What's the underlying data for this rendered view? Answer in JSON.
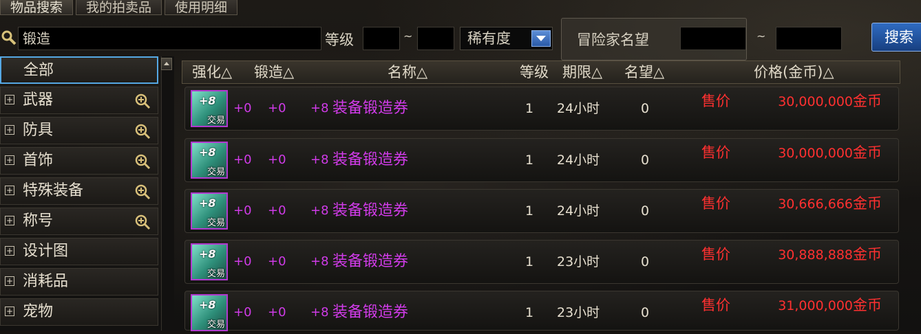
{
  "tabs": [
    {
      "label": "物品搜索"
    },
    {
      "label": "我的拍卖品"
    },
    {
      "label": "使用明细"
    }
  ],
  "search": {
    "keyword": "锻造",
    "level_label": "等级",
    "tilde": "~",
    "rarity_label": "稀有度",
    "reputation_label": "冒险家名望",
    "search_button": "搜索"
  },
  "sidebar": {
    "items": [
      {
        "label": "全部"
      },
      {
        "label": "武器"
      },
      {
        "label": "防具"
      },
      {
        "label": "首饰"
      },
      {
        "label": "特殊装备"
      },
      {
        "label": "称号"
      },
      {
        "label": "设计图"
      },
      {
        "label": "消耗品"
      },
      {
        "label": "宠物"
      }
    ]
  },
  "table": {
    "headers": {
      "enhance": "强化△",
      "forge": "锻造△",
      "name": "名称△",
      "level": "等级",
      "period": "期限△",
      "reputation": "名望△",
      "price": "价格(金币)△"
    },
    "rows": [
      {
        "icon_badge": "+8",
        "icon_sub": "交易",
        "enhance": "+0",
        "forge": "+0",
        "amp": "+8",
        "name": "装备锻造券",
        "level": "1",
        "period": "24小时",
        "reputation": "0",
        "sale": "售价",
        "price": "30,000,000",
        "unit": "金币"
      },
      {
        "icon_badge": "+8",
        "icon_sub": "交易",
        "enhance": "+0",
        "forge": "+0",
        "amp": "+8",
        "name": "装备锻造券",
        "level": "1",
        "period": "24小时",
        "reputation": "0",
        "sale": "售价",
        "price": "30,000,000",
        "unit": "金币"
      },
      {
        "icon_badge": "+8",
        "icon_sub": "交易",
        "enhance": "+0",
        "forge": "+0",
        "amp": "+8",
        "name": "装备锻造券",
        "level": "1",
        "period": "24小时",
        "reputation": "0",
        "sale": "售价",
        "price": "30,666,666",
        "unit": "金币"
      },
      {
        "icon_badge": "+8",
        "icon_sub": "交易",
        "enhance": "+0",
        "forge": "+0",
        "amp": "+8",
        "name": "装备锻造券",
        "level": "1",
        "period": "23小时",
        "reputation": "0",
        "sale": "售价",
        "price": "30,888,888",
        "unit": "金币"
      },
      {
        "icon_badge": "+8",
        "icon_sub": "交易",
        "enhance": "+0",
        "forge": "+0",
        "amp": "+8",
        "name": "装备锻造券",
        "level": "1",
        "period": "23小时",
        "reputation": "0",
        "sale": "售价",
        "price": "31,000,000",
        "unit": "金币"
      }
    ]
  }
}
